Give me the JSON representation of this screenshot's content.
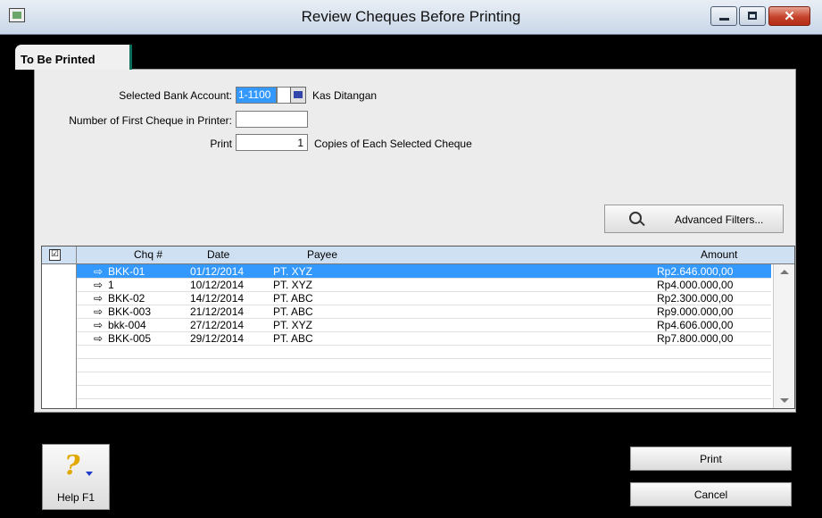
{
  "window": {
    "title": "Review Cheques Before Printing",
    "minimize_icon": "minimize-icon",
    "maximize_icon": "maximize-icon",
    "close_glyph": "✕"
  },
  "tab": {
    "label": "To Be Printed"
  },
  "form": {
    "bank_account_label": "Selected Bank Account:",
    "bank_account_value": "1-1100",
    "bank_account_name": "Kas Ditangan",
    "first_cheque_label": "Number of First Cheque in Printer:",
    "first_cheque_value": "",
    "print_label": "Print",
    "copies_value": "1",
    "copies_suffix": "Copies of Each Selected Cheque"
  },
  "advanced_filters": {
    "label": "Advanced Filters..."
  },
  "table": {
    "check_glyph": "☑",
    "columns": [
      "Chq #",
      "Date",
      "Payee",
      "Amount"
    ],
    "rows": [
      {
        "chq": "BKK-01",
        "date": "01/12/2014",
        "payee": "PT. XYZ",
        "amount": "Rp2.646.000,00",
        "selected": true
      },
      {
        "chq": "1",
        "date": "10/12/2014",
        "payee": "PT. XYZ",
        "amount": "Rp4.000.000,00",
        "selected": false
      },
      {
        "chq": "BKK-02",
        "date": "14/12/2014",
        "payee": "PT. ABC",
        "amount": "Rp2.300.000,00",
        "selected": false
      },
      {
        "chq": "BKK-003",
        "date": "21/12/2014",
        "payee": "PT. ABC",
        "amount": "Rp9.000.000,00",
        "selected": false
      },
      {
        "chq": "bkk-004",
        "date": "27/12/2014",
        "payee": "PT. XYZ",
        "amount": "Rp4.606.000,00",
        "selected": false
      },
      {
        "chq": "BKK-005",
        "date": "29/12/2014",
        "payee": "PT. ABC",
        "amount": "Rp7.800.000,00",
        "selected": false
      }
    ],
    "row_arrow": "⇨"
  },
  "footer": {
    "help_label": "Help F1",
    "help_glyph": "?",
    "print_label": "Print",
    "cancel_label": "Cancel"
  },
  "colors": {
    "selection": "#3399ff",
    "header_bg": "#cfe0f3",
    "close_button": "#c5432b"
  }
}
